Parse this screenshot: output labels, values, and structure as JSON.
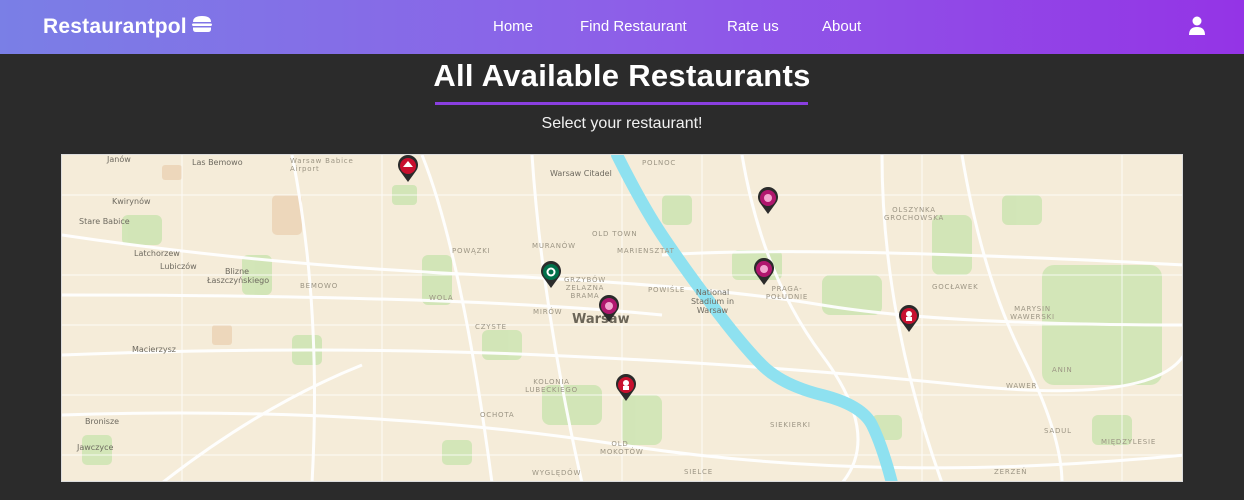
{
  "navbar": {
    "brand": "Restaurantpol",
    "links": [
      {
        "label": "Home"
      },
      {
        "label": "Find Restaurant"
      },
      {
        "label": "Rate us"
      },
      {
        "label": "About"
      }
    ],
    "gradient": [
      "#7a7fe6",
      "#9434e6"
    ]
  },
  "main": {
    "title": "All Available Restaurants",
    "subtitle": "Select your restaurant!",
    "accent_color": "#8a3fe0"
  },
  "map": {
    "city_label": "Warsaw",
    "labels": [
      "Janów",
      "Las Bemowo",
      "Warsaw Babice Airport",
      "Warsaw Citadel",
      "POLNOC",
      "Kwirynów",
      "Stare Babice",
      "Latchorzew",
      "Lubiczów",
      "Blizne Łaszczyńskiego",
      "BEMOWO",
      "POWĄZKI",
      "MURANÓW",
      "OLD TOWN",
      "MARIENSZTAT",
      "WOLA",
      "GRZYBÓW ZELAZNA BRAMA",
      "POWIŚLE",
      "National Stadium in Warsaw",
      "PRAGA-POŁUDNIE",
      "OLSZYNKA GROCHOWSKA",
      "GOCŁAWEK",
      "MARYSIN WAWERSKI",
      "MIRÓW",
      "CZYSTE",
      "Macierzysz",
      "KOLONIA LUBECKIEGO",
      "OCHOTA",
      "WAWER",
      "ANIN",
      "Bronisze",
      "Jawczyce",
      "OLD MOKOTÓW",
      "SIEKIERKI",
      "SADUL",
      "MIĘDZYLESIE",
      "WYGLĘDÓW",
      "SIELCE",
      "ZERZEŃ"
    ],
    "markers": [
      {
        "name": "pizza-hut",
        "color": "#c8102e"
      },
      {
        "name": "burger-place",
        "color": "#b0166e"
      },
      {
        "name": "starbucks",
        "color": "#00704a"
      },
      {
        "name": "pink-restaurant",
        "color": "#b0166e"
      },
      {
        "name": "dessert-place",
        "color": "#b0166e"
      },
      {
        "name": "kfc",
        "color": "#c8102e"
      },
      {
        "name": "kfc",
        "color": "#c8102e"
      }
    ]
  }
}
